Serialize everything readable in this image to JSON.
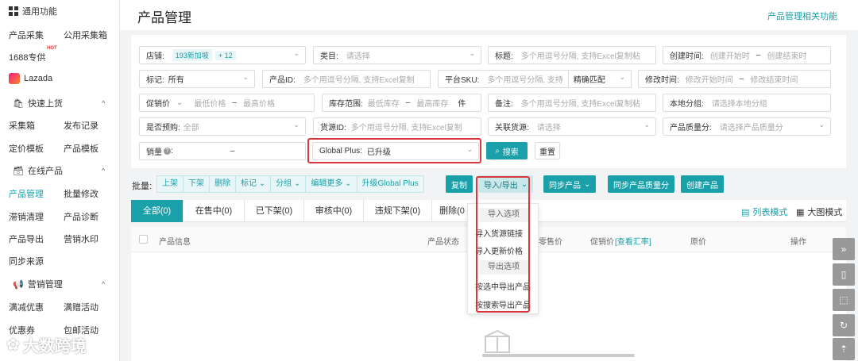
{
  "sidebar": {
    "section_common": "通用功能",
    "row1": [
      "产品采集",
      "公用采集箱"
    ],
    "row2": "1688专供",
    "hot": "HOT",
    "platform": "Lazada",
    "section_quick": "快速上货",
    "row3": [
      "采集箱",
      "发布记录"
    ],
    "row4": [
      "定价模板",
      "产品模板"
    ],
    "section_online": "在线产品",
    "row5": [
      "产品管理",
      "批量修改"
    ],
    "row6": [
      "滞销清理",
      "产品诊断"
    ],
    "row7": [
      "产品导出",
      "营销水印"
    ],
    "row8": "同步来源",
    "section_marketing": "营销管理",
    "row9": [
      "满减优惠",
      "满赠活动"
    ],
    "row10": [
      "优惠券",
      "包邮活动"
    ],
    "arrow": "^"
  },
  "header": {
    "title": "产品管理",
    "link": "产品管理相关功能"
  },
  "filters": {
    "shop_label": "店铺:",
    "shop_tag": "193新加坡",
    "shop_more": "+ 12",
    "category_label": "类目:",
    "category_ph": "请选择",
    "title_label": "标题:",
    "title_ph": "多个用逗号分隔, 支持Excel复制粘",
    "created_label": "创建时间:",
    "created_start": "创建开始时",
    "created_end": "创建结束时",
    "mark_label": "标记:",
    "mark_value": "所有",
    "pid_label": "产品ID:",
    "pid_ph": "多个用逗号分隔, 支持Excel复制",
    "sku_label": "平台SKU:",
    "sku_ph": "多个用逗号分隔, 支持",
    "sku_match": "精确匹配",
    "modified_label": "修改时间:",
    "modified_start": "修改开始时间",
    "modified_end": "修改结束时间",
    "promo_label": "促销价",
    "price_min": "最低价格",
    "price_max": "最高价格",
    "stock_label": "库存范围:",
    "stock_min": "最低库存",
    "stock_max": "最高库存",
    "stock_unit": "件",
    "note_label": "备注:",
    "note_ph": "多个用逗号分隔, 支持Excel复制粘",
    "group_label": "本地分组:",
    "group_ph": "请选择本地分组",
    "presale_label": "是否预购:",
    "presale_value": "全部",
    "source_label": "货源ID:",
    "source_ph": "多个用逗号分隔, 支持Excel复制",
    "linked_label": "关联货源:",
    "linked_ph": "请选择",
    "quality_label": "产品质量分:",
    "quality_ph": "请选择产品质量分",
    "sales_label": "销量",
    "sales_dash": "–",
    "global_label": "Global Plus:",
    "global_value": "已升级",
    "search_btn": "搜索",
    "reset_btn": "重置",
    "dash": "–",
    "chevron": "⌄"
  },
  "batch": {
    "label": "批量:",
    "group": [
      "上架",
      "下架",
      "删除",
      "标记 ⌄",
      "分组 ⌄",
      "编辑更多 ⌄",
      "升级Global Plus"
    ],
    "copy": "复制",
    "import_export": "导入/导出",
    "sync": "同步产品",
    "sync_quality": "同步产品质量分",
    "create": "创建产品"
  },
  "tabs": [
    {
      "label": "全部(0)",
      "active": true
    },
    {
      "label": "在售中(0)"
    },
    {
      "label": "已下架(0)"
    },
    {
      "label": "审核中(0)"
    },
    {
      "label": "违规下架(0)"
    },
    {
      "label": "删除(0"
    }
  ],
  "view_modes": {
    "list": "列表模式",
    "grid": "大图模式"
  },
  "table": {
    "columns": [
      "产品信息",
      "产品状态",
      "零售价",
      "促销价",
      "[查看汇率]",
      "原价",
      "操作"
    ]
  },
  "dropdown": {
    "import_section": "导入选项",
    "import_items": [
      "导入货源链接",
      "导入更新价格"
    ],
    "export_section": "导出选项",
    "export_items": [
      "按选中导出产品",
      "按搜索导出产品"
    ]
  },
  "watermark": "大数跨境",
  "colors": {
    "accent": "#1aa0a8",
    "highlight": "#d9363e"
  },
  "icons": [
    "grid-icon",
    "lazada-logo",
    "bag-icon",
    "box-icon",
    "megaphone-icon",
    "search-icon",
    "list-icon",
    "chevron-down-icon",
    "expand-icon",
    "phone-icon",
    "save-icon",
    "refresh-icon",
    "top-icon"
  ]
}
